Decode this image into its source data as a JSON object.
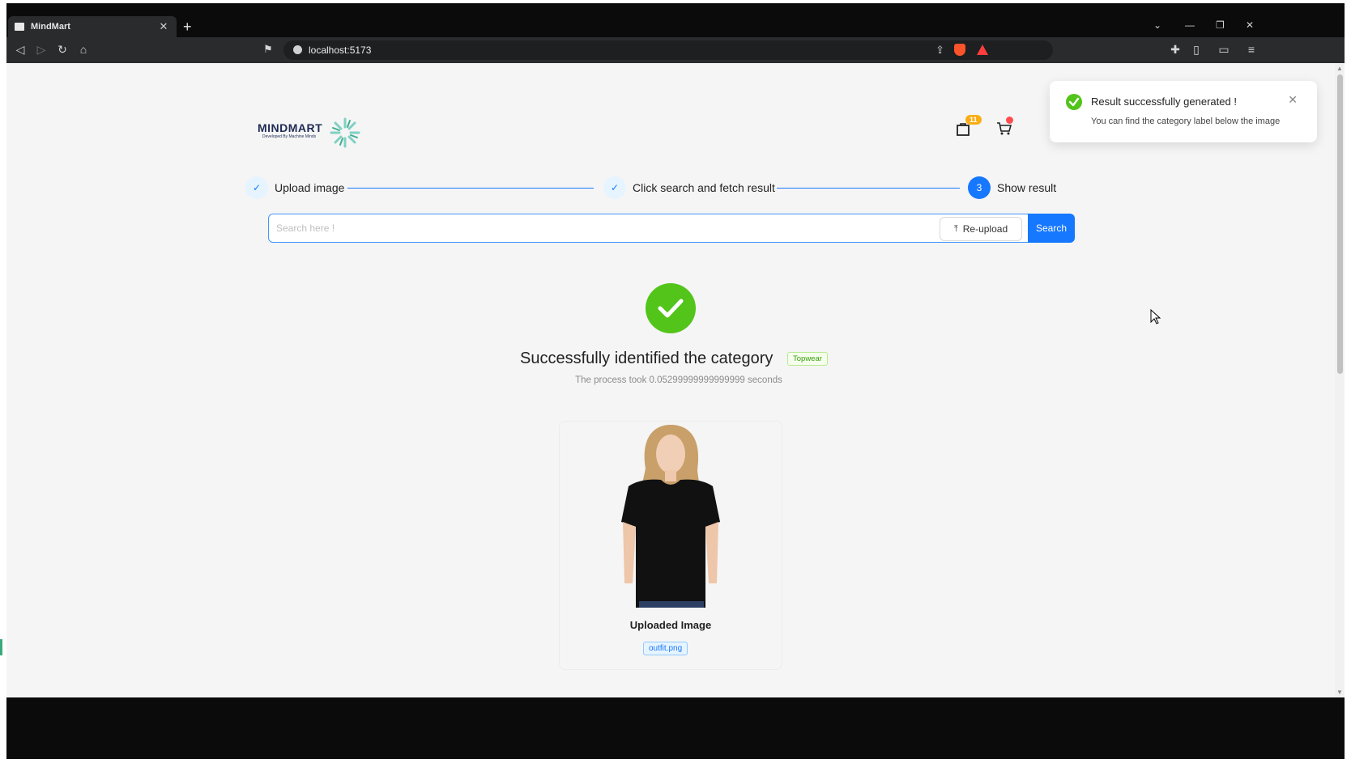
{
  "browser": {
    "tab_title": "MindMart",
    "tab_close": "✕",
    "new_tab": "+",
    "url": "localhost:5173",
    "window_controls": [
      "⌄",
      "—",
      "❐",
      "✕"
    ]
  },
  "header": {
    "logo_text": "MINDMART",
    "logo_tagline": "Developed By Machine Minds",
    "bag_count": "11",
    "cart_count": ""
  },
  "steps": [
    {
      "label": "Upload image",
      "state": "done",
      "marker": "✓"
    },
    {
      "label": "Click search and fetch result",
      "state": "done",
      "marker": "✓"
    },
    {
      "label": "Show result",
      "state": "active",
      "marker": "3"
    }
  ],
  "search": {
    "placeholder": "Search here !",
    "reupload_label": "Re-upload",
    "search_label": "Search"
  },
  "result": {
    "title": "Successfully identified the category",
    "category": "Topwear",
    "process_text": "The process took 0.05299999999999999 seconds",
    "card_caption": "Uploaded Image",
    "file_name": "outfit.png"
  },
  "notification": {
    "title": "Result successfully generated !",
    "description": "You can find the category label below the image",
    "close": "✕"
  },
  "colors": {
    "primary": "#1677ff",
    "success": "#52c41a",
    "badge": "#faad14"
  }
}
